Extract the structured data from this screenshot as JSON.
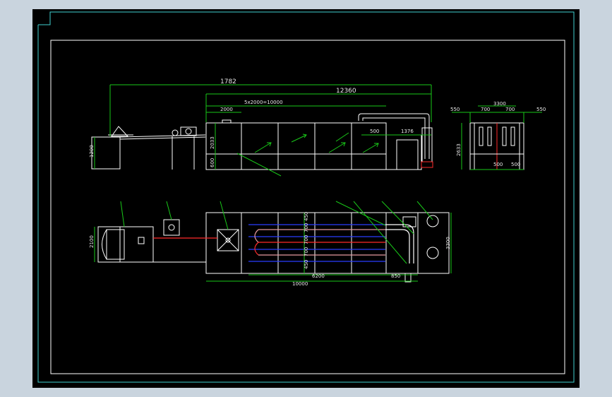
{
  "colors": {
    "background": "#000000",
    "outer_bg": "#c9d4de",
    "frame_outer": "#3fd1cf",
    "frame_inner": "#ffffff",
    "dimension": "#19c819",
    "geometry": "#ffffff",
    "pipe_blue": "#2b3cff",
    "pipe_red": "#ff2a2a",
    "pipe_pink": "#e79aa0"
  },
  "icons": [
    "flow-arrow-icon",
    "fan-impeller-icon",
    "valve-icon"
  ],
  "dimensions": {
    "elevation": {
      "overall_length": "1782",
      "tank_length": "12360",
      "segments": "5x2000=10000",
      "segment": "2000",
      "height_total": "2033",
      "height_leg": "600",
      "height_feeder": "1200",
      "gap_500": "500",
      "gap_1376": "1376"
    },
    "side": {
      "width": "3300",
      "left_margin": "550",
      "inner_700_a": "700",
      "inner_700_b": "700",
      "right_margin": "550",
      "height": "2633",
      "bottom_500_a": "500",
      "bottom_500_b": "500"
    },
    "plan": {
      "width_left": "2100",
      "length": "10000",
      "heater_length": "6200",
      "right_gap": "850",
      "width": "3300",
      "row_450_a": "450",
      "row_700_a": "700",
      "row_700_b": "700",
      "row_700_c": "700",
      "row_450_b": "450"
    }
  }
}
